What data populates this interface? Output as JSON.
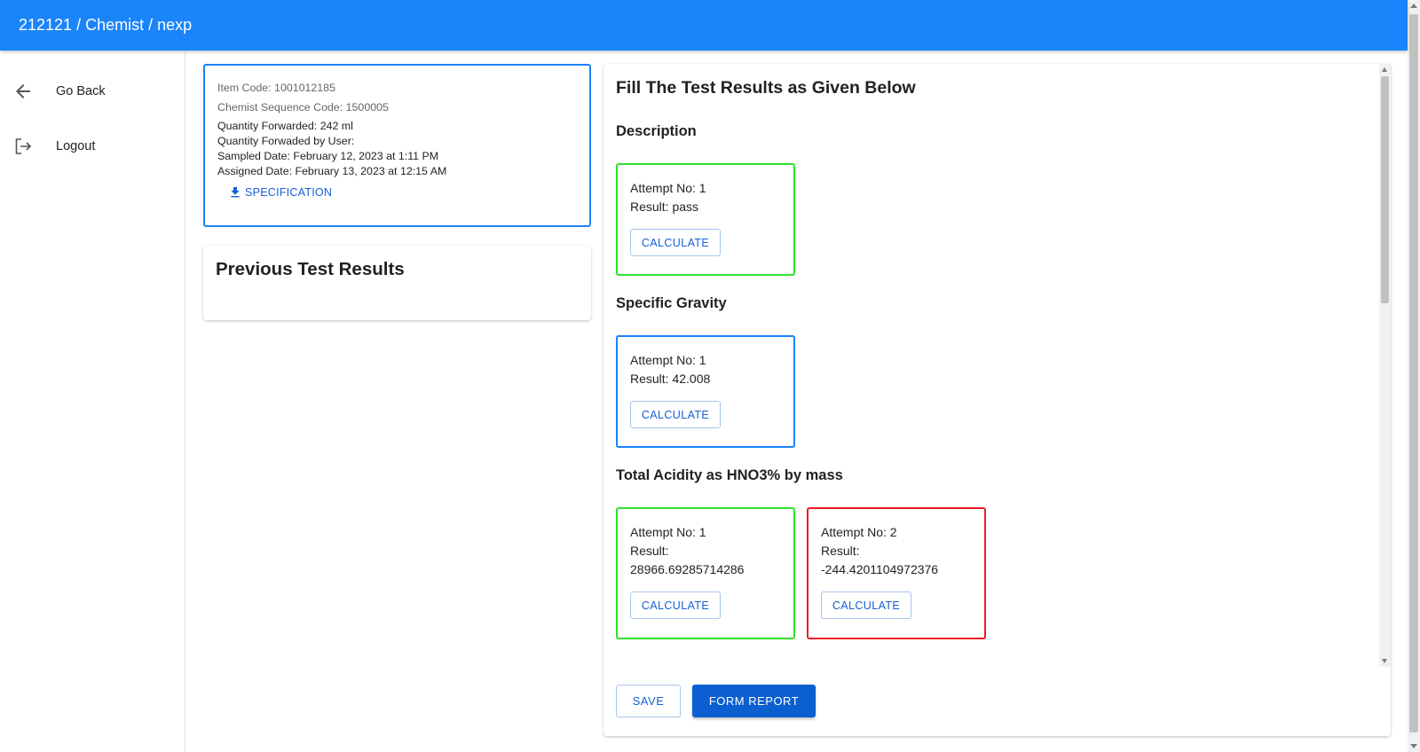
{
  "appbar": {
    "title": "212121 / Chemist / nexp"
  },
  "nav": {
    "items": [
      {
        "label": "Go Back",
        "icon": "arrow-back-icon"
      },
      {
        "label": "Logout",
        "icon": "logout-icon"
      }
    ]
  },
  "info": {
    "item_code": "Item Code: 1001012185",
    "sequence_code": "Chemist Sequence Code: 1500005",
    "quantity_forwarded": "Quantity Forwarded: 242 ml",
    "quantity_by_user": "Quantity Forwaded by User:",
    "sampled_date": "Sampled Date: February 12, 2023 at 1:11 PM",
    "assigned_date": "Assigned Date: February 13, 2023 at 12:15 AM",
    "spec_button": "SPECIFICATION"
  },
  "previous": {
    "title": "Previous Test Results"
  },
  "main": {
    "title": "Fill The Test Results as Given Below",
    "sections": [
      {
        "title": "Description",
        "attempts": [
          {
            "attempt": "Attempt No: 1",
            "result_label": "Result: pass",
            "result_value": "",
            "status_color": "#2fe02f",
            "button": "CALCULATE"
          }
        ]
      },
      {
        "title": "Specific Gravity",
        "attempts": [
          {
            "attempt": "Attempt No: 1",
            "result_label": "Result: 42.008",
            "result_value": "",
            "status_color": "#1a84fb",
            "button": "CALCULATE"
          }
        ]
      },
      {
        "title": "Total Acidity as HNO3% by mass",
        "attempts": [
          {
            "attempt": "Attempt No: 1",
            "result_label": "Result:",
            "result_value": "28966.69285714286",
            "status_color": "#2fe02f",
            "button": "CALCULATE"
          },
          {
            "attempt": "Attempt No: 2",
            "result_label": "Result:",
            "result_value": "-244.4201104972376",
            "status_color": "#ee1c25",
            "button": "CALCULATE"
          }
        ]
      }
    ],
    "save_button": "SAVE",
    "report_button": "FORM REPORT"
  },
  "colors": {
    "appbar": "#1a84fb",
    "primary_button": "#0c5fd1",
    "pass": "#2fe02f",
    "fail": "#ee1c25",
    "active": "#1a84fb"
  }
}
